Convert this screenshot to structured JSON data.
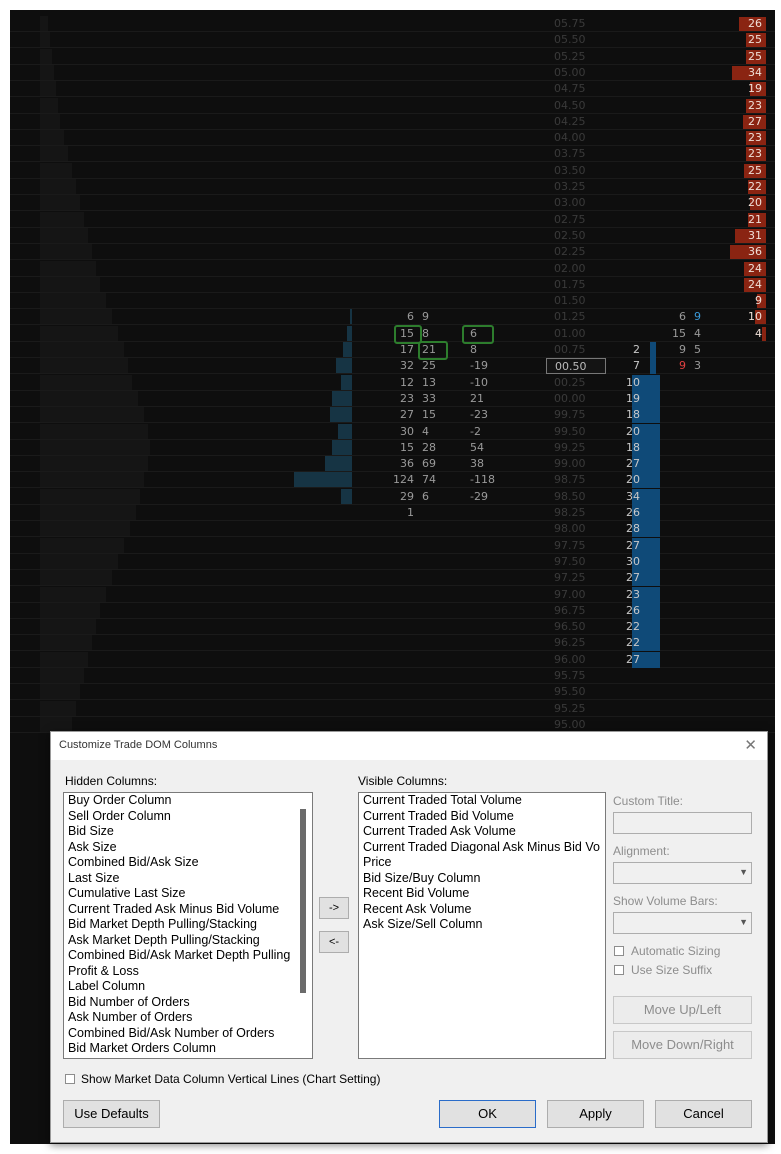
{
  "prices": [
    "05.75",
    "05.50",
    "05.25",
    "05.00",
    "04.75",
    "04.50",
    "04.25",
    "04.00",
    "03.75",
    "03.50",
    "03.25",
    "03.00",
    "02.75",
    "02.50",
    "02.25",
    "02.00",
    "01.75",
    "01.50",
    "01.25",
    "01.00",
    "00.75",
    "00.50",
    "00.25",
    "00.00",
    "99.75",
    "99.50",
    "99.25",
    "99.00",
    "98.75",
    "98.50",
    "98.25",
    "98.00",
    "97.75",
    "97.50",
    "97.25",
    "97.00",
    "96.75",
    "96.50",
    "96.25",
    "96.00",
    "95.75",
    "95.50",
    "95.25",
    "95.00"
  ],
  "current_price": "00.50",
  "ask_sizes": [
    "26",
    "25",
    "25",
    "34",
    "19",
    "23",
    "27",
    "23",
    "23",
    "25",
    "22",
    "20",
    "21",
    "31",
    "36",
    "24",
    "24",
    "9",
    "10",
    "4"
  ],
  "ask_size_level": [
    0.75,
    0.55,
    0.55,
    0.95,
    0.45,
    0.55,
    0.65,
    0.55,
    0.55,
    0.6,
    0.5,
    0.45,
    0.5,
    0.85,
    1.0,
    0.6,
    0.6,
    0.25,
    0.3,
    0.12
  ],
  "bid_sizes": [
    "2",
    "7",
    "10",
    "19",
    "18",
    "20",
    "18",
    "27",
    "20",
    "34",
    "26",
    "28",
    "27",
    "30",
    "27",
    "23",
    "26",
    "22",
    "22",
    "27"
  ],
  "traded_volume": [
    {
      "bid": "6",
      "ask": "9",
      "diff": ""
    },
    {
      "bid": "15",
      "ask": "8",
      "diff": "6"
    },
    {
      "bid": "17",
      "ask": "21",
      "diff": "8"
    },
    {
      "bid": "32",
      "ask": "25",
      "diff": "-19"
    },
    {
      "bid": "12",
      "ask": "13",
      "diff": "-10"
    },
    {
      "bid": "23",
      "ask": "33",
      "diff": "21"
    },
    {
      "bid": "27",
      "ask": "15",
      "diff": "-23"
    },
    {
      "bid": "30",
      "ask": "4",
      "diff": "-2"
    },
    {
      "bid": "15",
      "ask": "28",
      "diff": "54"
    },
    {
      "bid": "36",
      "ask": "69",
      "diff": "38"
    },
    {
      "bid": "124",
      "ask": "74",
      "diff": "-118"
    },
    {
      "bid": "29",
      "ask": "6",
      "diff": "-29"
    },
    {
      "bid": "1",
      "ask": "",
      "diff": ""
    }
  ],
  "recent": [
    {
      "bid": "6",
      "ask": "9"
    },
    {
      "bid": "15",
      "ask": "4"
    },
    {
      "bid": "9",
      "ask": "5"
    },
    {
      "bid": "9",
      "ask": "3"
    }
  ],
  "dialog": {
    "title": "Customize Trade DOM Columns",
    "hidden_label": "Hidden Columns:",
    "visible_label": "Visible Columns:",
    "hidden_columns": [
      "Buy Order Column",
      "Sell Order Column",
      "Bid Size",
      "Ask Size",
      "Combined Bid/Ask Size",
      "Last Size",
      "Cumulative Last Size",
      "Current Traded Ask Minus Bid Volume",
      "Bid Market Depth Pulling/Stacking",
      "Ask Market Depth Pulling/Stacking",
      "Combined Bid/Ask Market Depth Pulling",
      "Profit & Loss",
      "Label Column",
      "Bid Number of Orders",
      "Ask Number of Orders",
      "Combined Bid/Ask Number of Orders",
      "Bid Market Orders Column"
    ],
    "visible_columns": [
      "Current Traded Total Volume",
      "Current Traded Bid Volume",
      "Current Traded Ask Volume",
      "Current Traded Diagonal Ask Minus Bid Vo",
      "Price",
      "Bid Size/Buy Column",
      "Recent Bid Volume",
      "Recent Ask Volume",
      "Ask Size/Sell Column"
    ],
    "move_right": "->",
    "move_left": "<-",
    "custom_title_label": "Custom Title:",
    "alignment_label": "Alignment:",
    "show_volume_bars_label": "Show Volume Bars:",
    "automatic_sizing": "Automatic Sizing",
    "use_size_suffix": "Use Size Suffix",
    "move_up_left": "Move Up/Left",
    "move_down_right": "Move Down/Right",
    "show_vertical_lines": "Show Market Data Column Vertical Lines (Chart Setting)",
    "use_defaults": "Use Defaults",
    "ok": "OK",
    "apply": "Apply",
    "cancel": "Cancel",
    "close_glyph": "✕"
  }
}
